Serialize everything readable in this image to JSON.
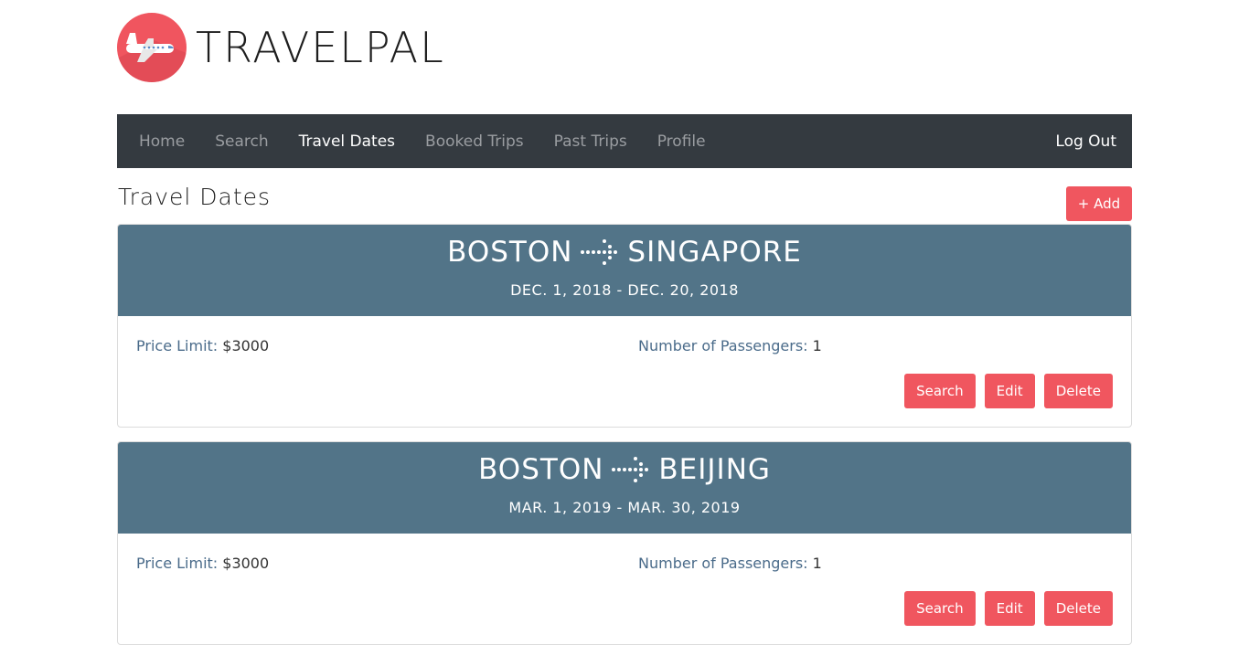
{
  "brand": {
    "name": "TRAVELPAL",
    "logo_icon": "airplane-icon",
    "logo_color": "#f0555f"
  },
  "nav": {
    "items": [
      {
        "label": "Home",
        "active": false
      },
      {
        "label": "Search",
        "active": false
      },
      {
        "label": "Travel Dates",
        "active": true
      },
      {
        "label": "Booked Trips",
        "active": false
      },
      {
        "label": "Past Trips",
        "active": false
      },
      {
        "label": "Profile",
        "active": false
      }
    ],
    "logout_label": "Log Out"
  },
  "page": {
    "title": "Travel Dates",
    "add_label": "+ Add"
  },
  "colors": {
    "accent": "#f0565f",
    "navbar": "#343a40",
    "card_header": "#527488"
  },
  "trips": [
    {
      "origin": "BOSTON",
      "destination": "SINGAPORE",
      "dates": "DEC. 1, 2018 - DEC. 20, 2018",
      "price_label": "Price Limit:",
      "price_value": "$3000",
      "pax_label": "Number of Passengers:",
      "pax_value": "1",
      "actions": {
        "search": "Search",
        "edit": "Edit",
        "delete": "Delete"
      }
    },
    {
      "origin": "BOSTON",
      "destination": "BEIJING",
      "dates": "MAR. 1, 2019 - MAR. 30, 2019",
      "price_label": "Price Limit:",
      "price_value": "$3000",
      "pax_label": "Number of Passengers:",
      "pax_value": "1",
      "actions": {
        "search": "Search",
        "edit": "Edit",
        "delete": "Delete"
      }
    }
  ]
}
